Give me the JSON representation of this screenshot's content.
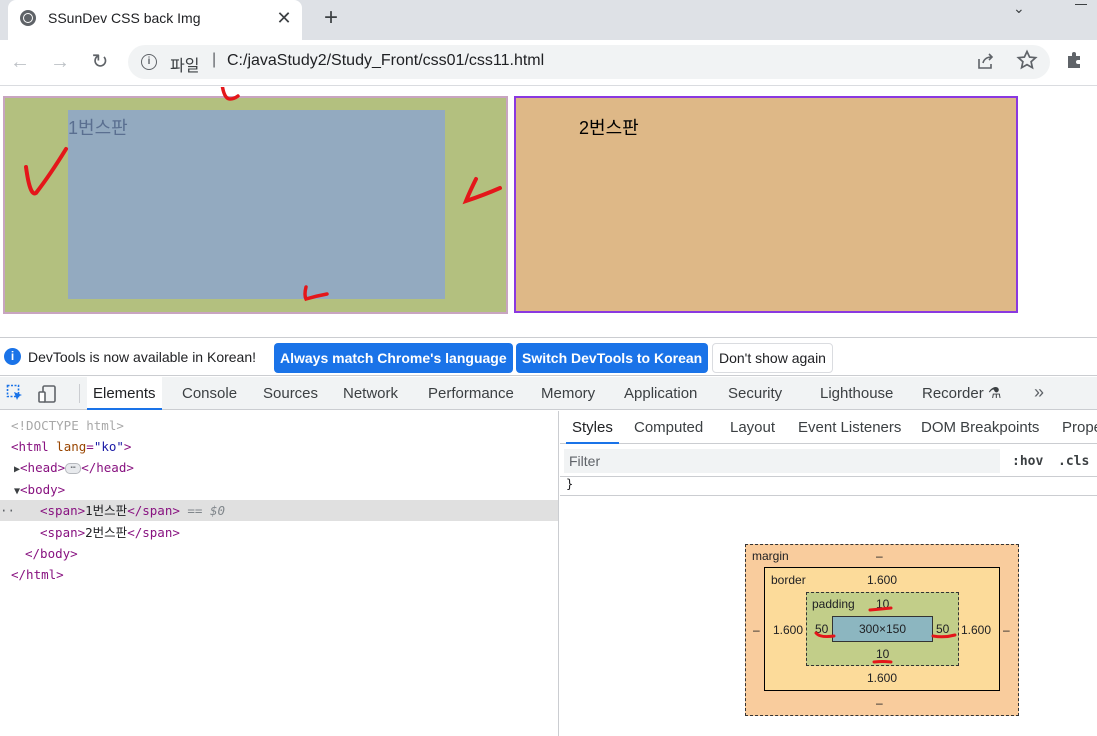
{
  "browser": {
    "tab_title": "SSunDev CSS back Img",
    "tab_close": "✕",
    "new_tab": "+",
    "menu_chevron": "⌄",
    "nav": {
      "back": "←",
      "forward": "→",
      "reload": "↻"
    },
    "omnibox": {
      "info_symbol": "i",
      "scheme_label": "파일",
      "separator": "|",
      "url": "C:/javaStudy2/Study_Front/css01/css11.html"
    },
    "icons": [
      "info-icon",
      "share-icon",
      "star-icon",
      "extensions-icon"
    ]
  },
  "page": {
    "span1_text": "1번스판",
    "span2_text": "2번스판",
    "colors": {
      "span1_bg": "#b3c07f",
      "span1_content": "#93aac0",
      "span2_bg": "#deb887",
      "span2_border": "#8a38e0"
    }
  },
  "devtools": {
    "infobar": {
      "icon": "i",
      "message": "DevTools is now available in Korean!",
      "btn_match": "Always match Chrome's language",
      "btn_switch": "Switch DevTools to Korean",
      "btn_dismiss": "Don't show again"
    },
    "tabs": [
      "Elements",
      "Console",
      "Sources",
      "Network",
      "Performance",
      "Memory",
      "Application",
      "Security",
      "Lighthouse",
      "Recorder ⚗"
    ],
    "more_tabs": "»",
    "active_tab": "Elements",
    "dom": {
      "doctype": "<!DOCTYPE html>",
      "html_open_tag": "<html",
      "html_attr": "lang",
      "html_attr_val": "\"ko\"",
      "html_open_close": ">",
      "head_open": "<head>",
      "head_ellipsis": "⋯",
      "head_close": "</head>",
      "body_open": "<body>",
      "span_open": "<span>",
      "span1_text": "1번스판",
      "span_close": "</span>",
      "selected_marker": "== $0",
      "span2_text": "2번스판",
      "body_close": "</body>",
      "html_close": "</html>",
      "dots": "··"
    },
    "styles_tabs": [
      "Styles",
      "Computed",
      "Layout",
      "Event Listeners",
      "DOM Breakpoints",
      "Prope"
    ],
    "active_styles_tab": "Styles",
    "filter_placeholder": "Filter",
    "hov": ":hov",
    "cls": ".cls",
    "brace": "}",
    "box_model": {
      "margin_label": "margin",
      "margin_top": "–",
      "margin_bottom": "–",
      "margin_left": "–",
      "margin_right": "–",
      "border_label": "border",
      "border_top": "1.600",
      "border_bottom": "1.600",
      "border_left": "1.600",
      "border_right": "1.600",
      "padding_label": "padding",
      "padding_top": "10",
      "padding_bottom": "10",
      "padding_left": "50",
      "padding_right": "50",
      "content": "300×150"
    }
  }
}
